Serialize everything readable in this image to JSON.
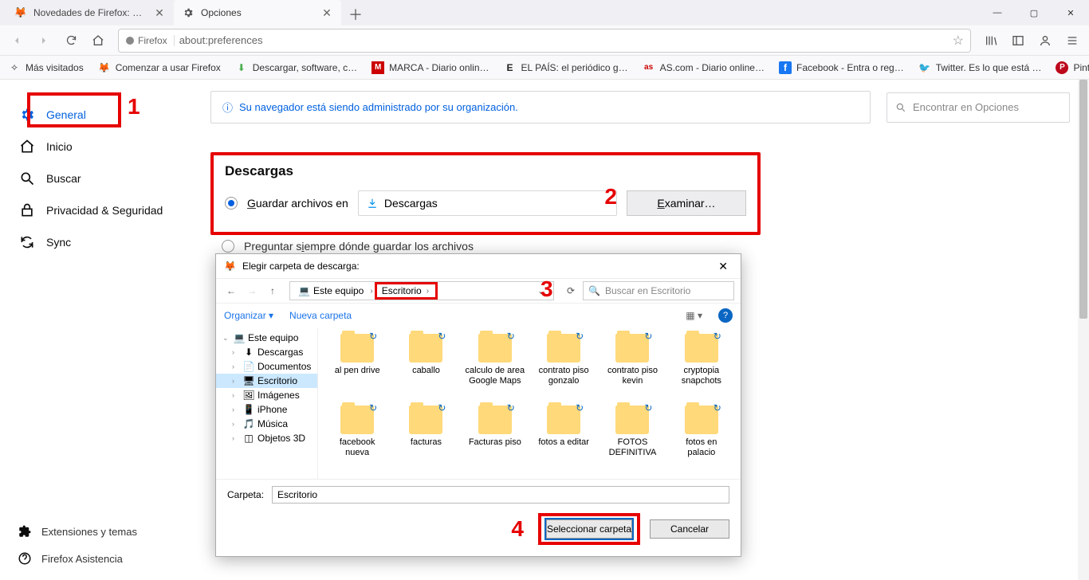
{
  "window": {
    "tabs": [
      {
        "label": "Novedades de Firefox: usa Firef"
      },
      {
        "label": "Opciones"
      }
    ],
    "min": "—",
    "max": "▢",
    "close": "✕",
    "newtab": "＋"
  },
  "nav": {
    "brand": "Firefox",
    "url": "about:preferences"
  },
  "bookmarks": [
    {
      "icon": "☆",
      "label": "Más visitados"
    },
    {
      "icon": "🦊",
      "label": "Comenzar a usar Firefox",
      "color": "#ff9500"
    },
    {
      "icon": "⬇",
      "label": "Descargar, software, c…",
      "color": "#4caf50"
    },
    {
      "icon": "M",
      "label": "MARCA - Diario onlin…",
      "color": "#cc0000"
    },
    {
      "icon": "E",
      "label": "EL PAÍS: el periódico g…",
      "color": "#222"
    },
    {
      "icon": "as",
      "label": "AS.com - Diario online…",
      "color": "#cc0000"
    },
    {
      "icon": "f",
      "label": "Facebook - Entra o reg…",
      "color": "#1877f2"
    },
    {
      "icon": "🐦",
      "label": "Twitter. Es lo que está …",
      "color": "#1da1f2"
    },
    {
      "icon": "P",
      "label": "Pinterest",
      "color": "#bd081c"
    }
  ],
  "sidebar": {
    "items": [
      {
        "icon": "gear",
        "label": "General",
        "selected": true
      },
      {
        "icon": "home",
        "label": "Inicio"
      },
      {
        "icon": "search",
        "label": "Buscar"
      },
      {
        "icon": "lock",
        "label": "Privacidad & Seguridad"
      },
      {
        "icon": "sync",
        "label": "Sync"
      }
    ],
    "footer": [
      {
        "icon": "puzzle",
        "label": "Extensiones y temas"
      },
      {
        "icon": "help",
        "label": "Firefox Asistencia"
      }
    ]
  },
  "info_banner": "Su navegador está siendo administrado por su organización.",
  "search_placeholder": "Encontrar en Opciones",
  "downloads": {
    "heading": "Descargas",
    "save_label_pre": "G",
    "save_label": "uardar archivos en",
    "path_label": "Descargas",
    "browse_pre": "E",
    "browse_label": "xaminar…",
    "ask_label_pre": "Preguntar s",
    "ask_label": "iempre dónde guardar los archivos"
  },
  "callouts": {
    "c1": "1",
    "c2": "2",
    "c3": "3",
    "c4": "4"
  },
  "dialog": {
    "title": "Elegir carpeta de descarga:",
    "breadcrumb": [
      "Este equipo",
      "Escritorio"
    ],
    "search_placeholder": "Buscar en Escritorio",
    "organize": "Organizar ▾",
    "new_folder": "Nueva carpeta",
    "tree": [
      {
        "label": "Este equipo",
        "level": 0,
        "icon": "💻",
        "expanded": true
      },
      {
        "label": "Descargas",
        "level": 1,
        "icon": "⬇"
      },
      {
        "label": "Documentos",
        "level": 1,
        "icon": "📄"
      },
      {
        "label": "Escritorio",
        "level": 1,
        "icon": "🖥",
        "selected": true
      },
      {
        "label": "Imágenes",
        "level": 1,
        "icon": "🖼"
      },
      {
        "label": "iPhone",
        "level": 1,
        "icon": "📱"
      },
      {
        "label": "Música",
        "level": 1,
        "icon": "🎵"
      },
      {
        "label": "Objetos 3D",
        "level": 1,
        "icon": "◫"
      }
    ],
    "files": [
      "al pen drive",
      "caballo",
      "calculo de area Google Maps",
      "contrato piso gonzalo",
      "contrato piso kevin",
      "cryptopia snapchots",
      "facebook nueva",
      "facturas",
      "Facturas piso",
      "fotos a editar",
      "FOTOS DEFINITIVA",
      "fotos en palacio"
    ],
    "folder_label": "Carpeta:",
    "folder_value": "Escritorio",
    "select_btn": "Seleccionar carpeta",
    "cancel_btn": "Cancelar"
  }
}
